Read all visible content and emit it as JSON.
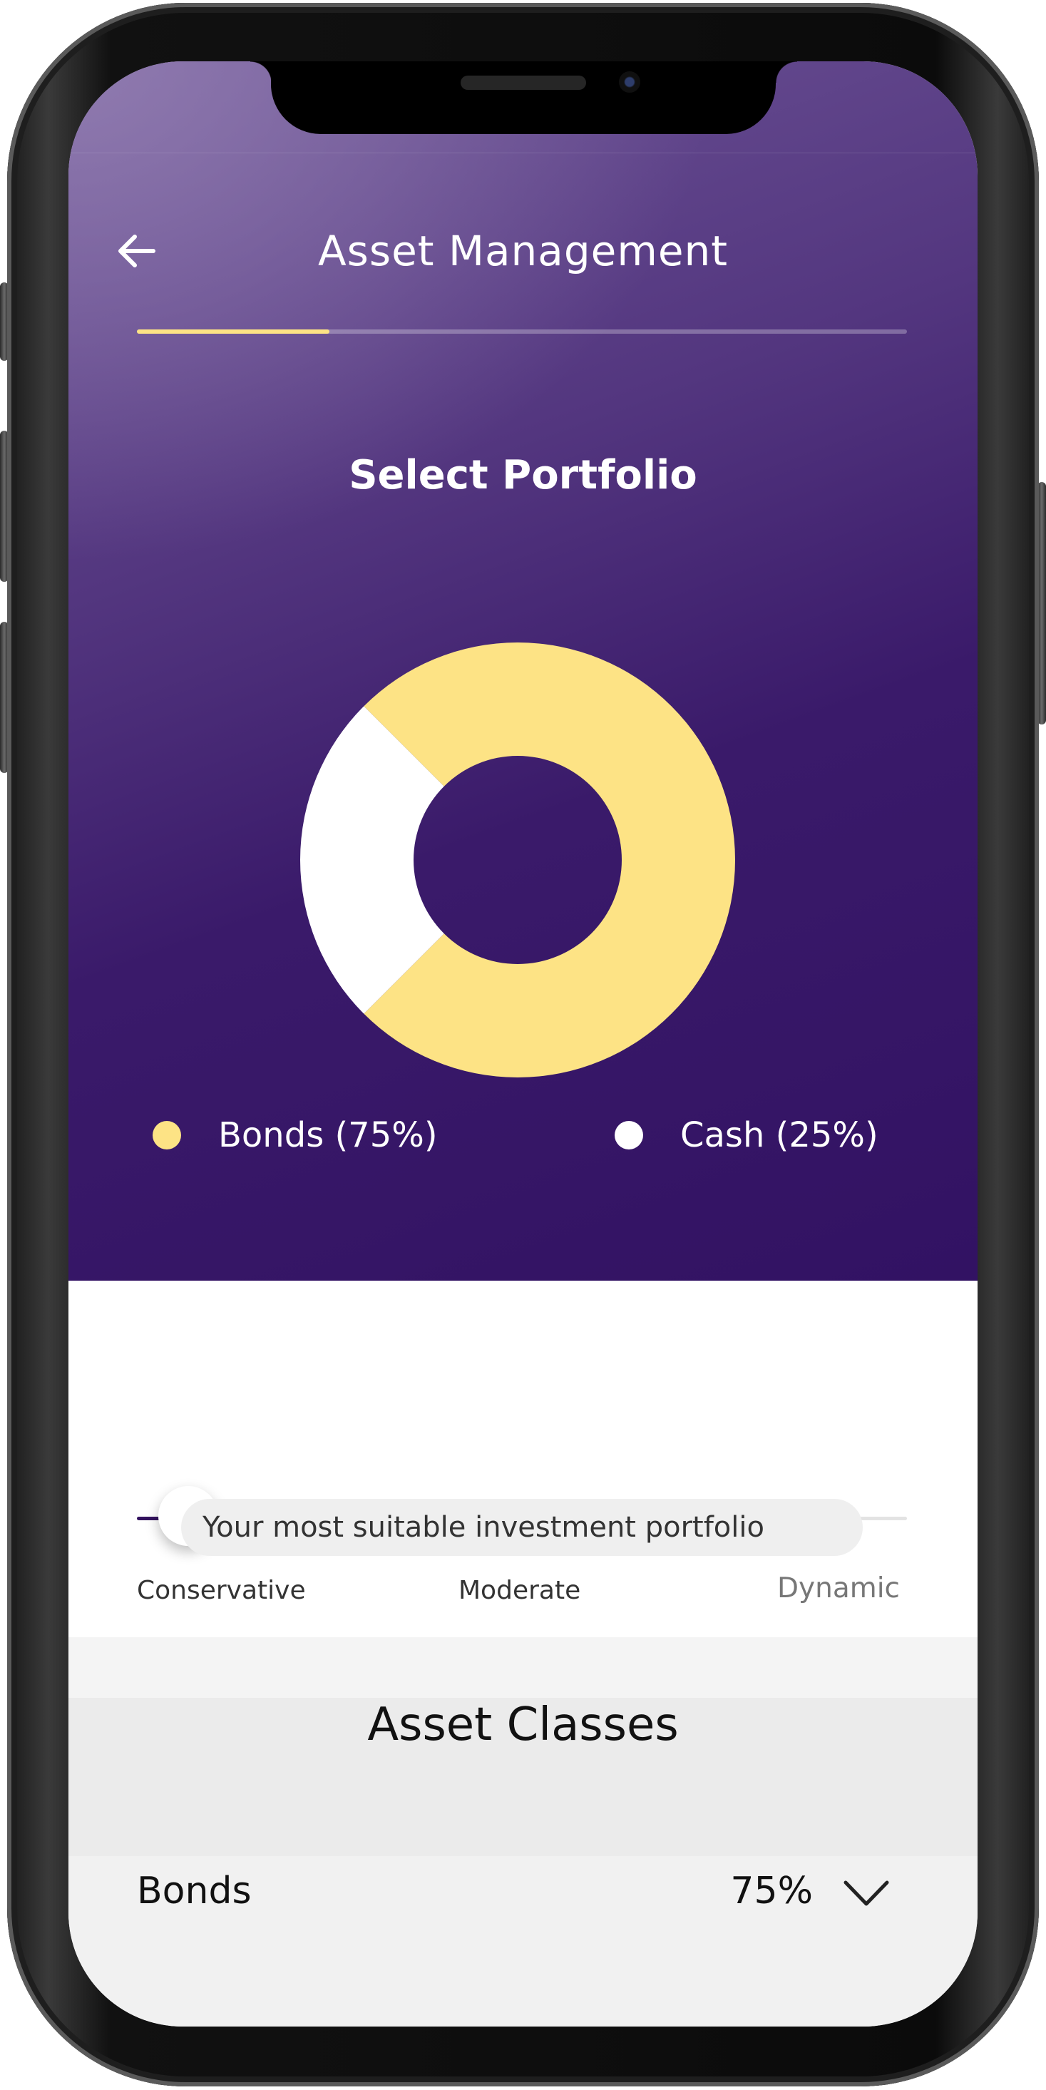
{
  "header": {
    "title": "Asset Management",
    "back_icon": "arrow-left-icon",
    "progress": 0.25
  },
  "portfolio": {
    "section_title": "Select Portfolio"
  },
  "chart_data": {
    "type": "pie",
    "donut": true,
    "categories": [
      "Bonds",
      "Cash"
    ],
    "values": [
      75,
      25
    ],
    "colors": [
      "#fde385",
      "#ffffff"
    ],
    "legend_labels": [
      "Bonds (75%)",
      "Cash (25%)"
    ],
    "legend_placement": "bottom"
  },
  "risk_slider": {
    "labels": [
      "Conservative",
      "Moderate",
      "Dynamic"
    ],
    "selected": "Conservative",
    "position": 0.15,
    "active_color": "#33125e",
    "inactive_color": "#e3e3e3"
  },
  "suggestion": {
    "text": "Your most suitable investment portfolio"
  },
  "asset_classes": {
    "title": "Asset Classes",
    "rows": [
      {
        "name": "Bonds",
        "value": "75%",
        "chevron_icon": "chevron-down-icon"
      }
    ]
  },
  "colors": {
    "accent_yellow": "#fde385",
    "purple_dark": "#321263",
    "purple_light": "#6e5597"
  }
}
